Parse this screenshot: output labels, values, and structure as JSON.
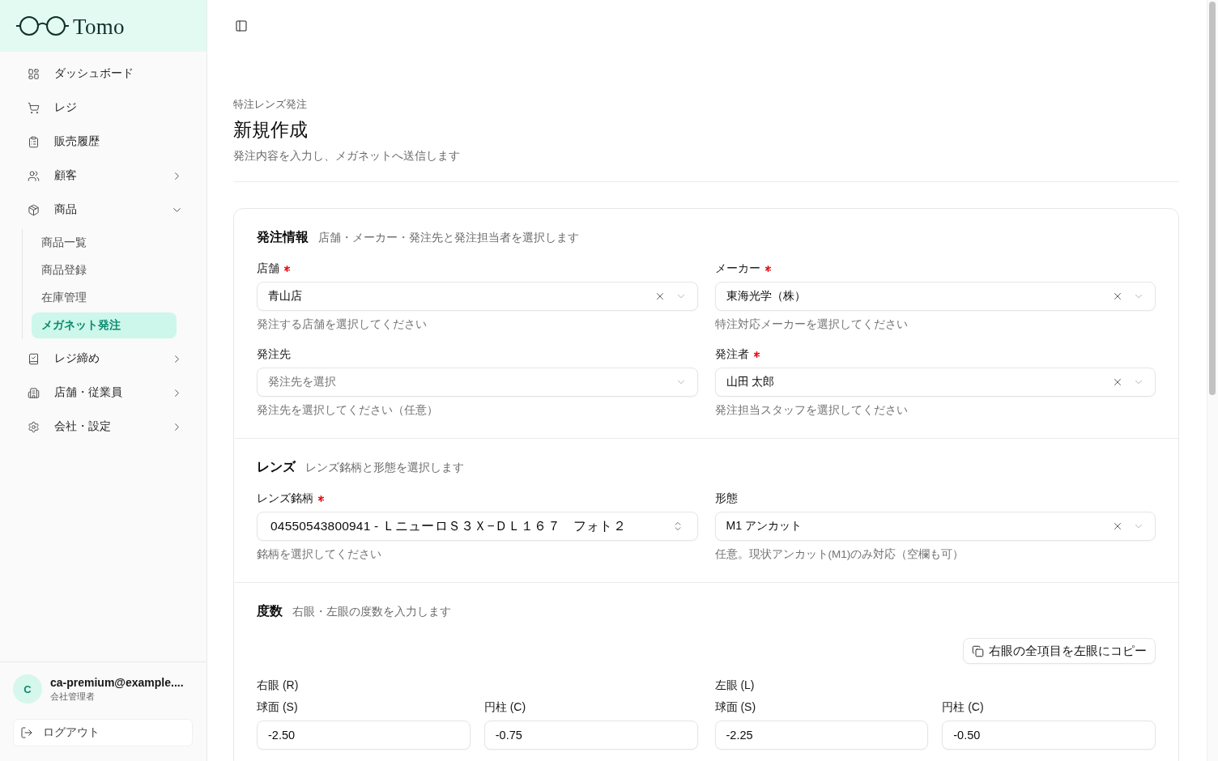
{
  "sidebar": {
    "logo": "Tomo",
    "nav": [
      {
        "label": "ダッシュボード",
        "kind": "link",
        "selected": false
      },
      {
        "label": "レジ",
        "kind": "link",
        "selected": false
      },
      {
        "label": "販売履歴",
        "kind": "link",
        "selected": false
      },
      {
        "label": "顧客",
        "kind": "group",
        "selected": false,
        "expanded": false
      },
      {
        "label": "商品",
        "kind": "group",
        "selected": false,
        "expanded": true,
        "children": [
          {
            "label": "商品一覧",
            "selected": false
          },
          {
            "label": "商品登録",
            "selected": false
          },
          {
            "label": "在庫管理",
            "selected": false
          },
          {
            "label": "メガネット発注",
            "selected": true
          }
        ]
      },
      {
        "label": "レジ締め",
        "kind": "group",
        "selected": false,
        "expanded": false
      },
      {
        "label": "店舗・従業員",
        "kind": "group",
        "selected": false,
        "expanded": false
      },
      {
        "label": "会社・設定",
        "kind": "group",
        "selected": false,
        "expanded": false
      }
    ],
    "user": {
      "initial": "C",
      "name": "ca-premium@example....",
      "role": "会社管理者"
    },
    "logout": "ログアウト"
  },
  "header": {
    "breadcrumb": "特注レンズ発注",
    "title": "新規作成",
    "description": "発注内容を入力し、メガネットへ送信します"
  },
  "sections": [
    {
      "kind": "form",
      "title": "発注情報",
      "description": "店舗・メーカー・発注先と発注担当者を選択します",
      "fields": [
        {
          "label": "店舗",
          "required": true,
          "kind": "select",
          "value": "青山店",
          "hint": "発注する店舗を選択してください"
        },
        {
          "label": "メーカー",
          "required": true,
          "kind": "select",
          "value": "東海光学（株）",
          "hint": "特注対応メーカーを選択してください"
        },
        {
          "label": "発注先",
          "required": false,
          "kind": "select",
          "placeholder": "発注先を選択",
          "hint": "発注先を選択してください（任意）"
        },
        {
          "label": "発注者",
          "required": true,
          "kind": "select",
          "value": "山田 太郎",
          "hint": "発注担当スタッフを選択してください"
        }
      ]
    },
    {
      "kind": "form",
      "title": "レンズ",
      "description": "レンズ銘柄と形態を選択します",
      "fields": [
        {
          "label": "レンズ銘柄",
          "required": true,
          "kind": "combobox",
          "value": "04550543800941 - ＬニューロＳ３Ｘ−ＤＬ１６７　フォト２",
          "hint": "銘柄を選択してください"
        },
        {
          "label": "形態",
          "required": false,
          "kind": "select",
          "value": "M1 アンカット",
          "hint": "任意。現状アンカット(M1)のみ対応（空欄も可）"
        }
      ]
    },
    {
      "kind": "prescription",
      "title": "度数",
      "description": "右眼・左眼の度数を入力します",
      "copy_button": "右眼の全項目を左眼にコピー",
      "eyes": [
        {
          "label": "右眼 (R)",
          "fields": [
            {
              "label": "球面 (S)",
              "value": "-2.50"
            },
            {
              "label": "円柱 (C)",
              "value": "-0.75"
            }
          ]
        },
        {
          "label": "左眼 (L)",
          "fields": [
            {
              "label": "球面 (S)",
              "value": "-2.25"
            },
            {
              "label": "円柱 (C)",
              "value": "-0.50"
            }
          ]
        }
      ]
    }
  ]
}
